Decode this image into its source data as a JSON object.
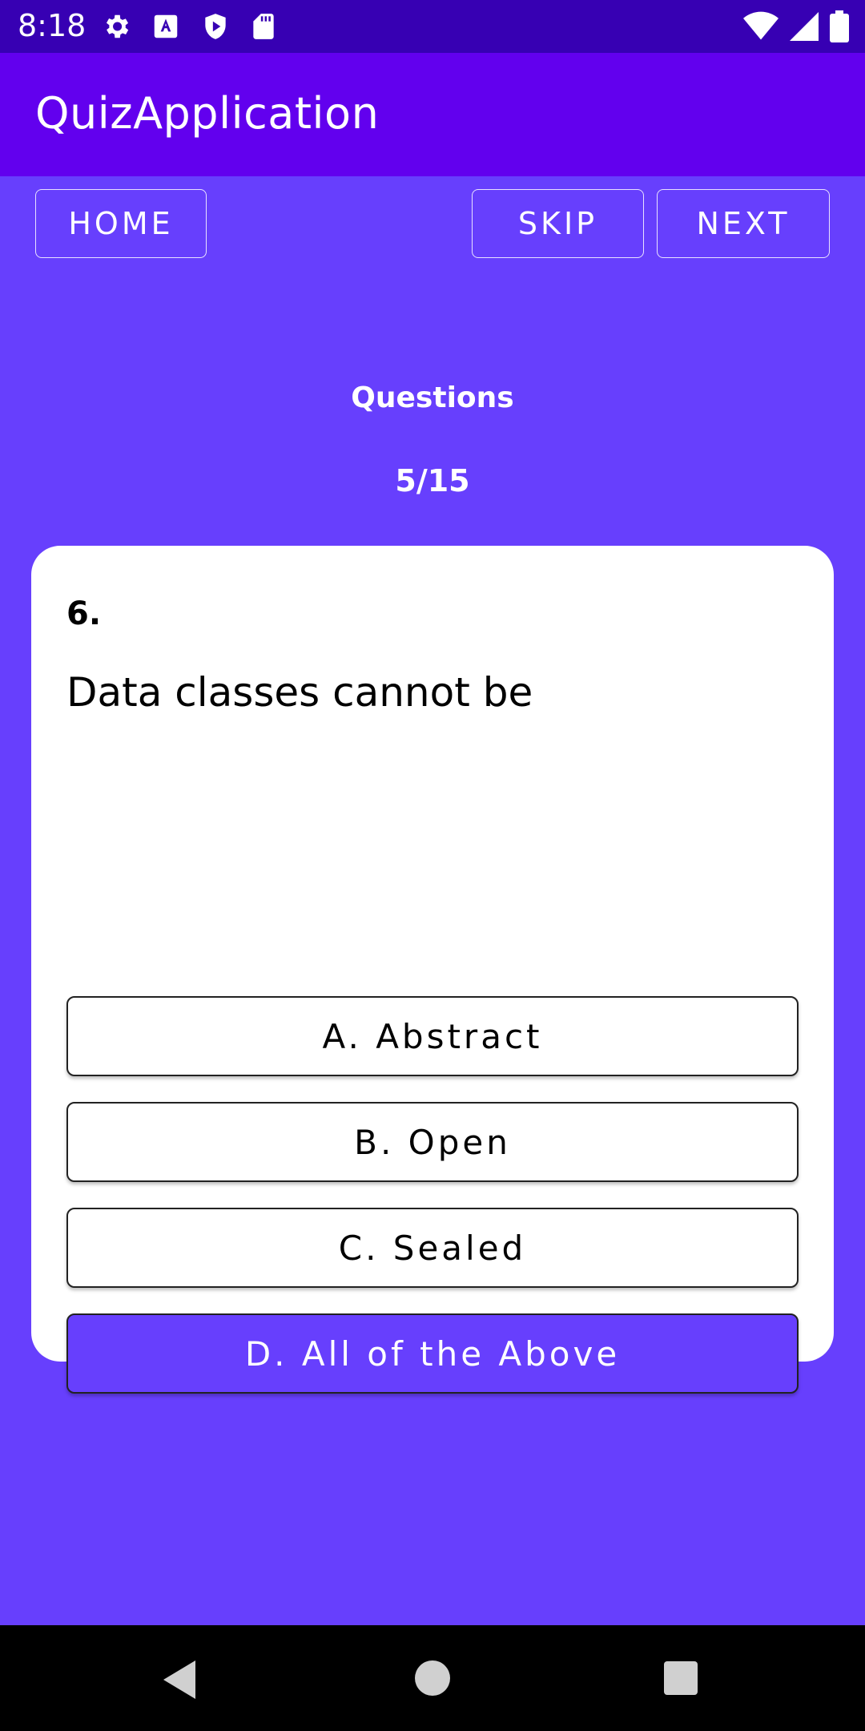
{
  "status_bar": {
    "time": "8:18",
    "left_icons": [
      "gear-icon",
      "font-a-icon",
      "play-shield-icon",
      "sd-card-icon"
    ],
    "right_icons": [
      "wifi-icon",
      "signal-icon",
      "battery-icon"
    ]
  },
  "app_bar": {
    "title": "QuizApplication"
  },
  "toolbar": {
    "home_label": "HOME",
    "skip_label": "SKIP",
    "next_label": "NEXT"
  },
  "progress": {
    "label": "Questions",
    "count": "5/15"
  },
  "question": {
    "number": "6.",
    "text": "Data classes cannot be",
    "options": [
      {
        "label": "A. Abstract",
        "selected": false
      },
      {
        "label": "B. Open",
        "selected": false
      },
      {
        "label": "C. Sealed",
        "selected": false
      },
      {
        "label": "D. All of the Above",
        "selected": true
      }
    ]
  },
  "colors": {
    "status_bar": "#3700b3",
    "app_bar": "#6200ee",
    "background": "#673ffd",
    "selected_option": "#673ffd"
  },
  "nav_bar": {
    "icons": [
      "back-icon",
      "home-circle-icon",
      "recents-icon"
    ]
  }
}
